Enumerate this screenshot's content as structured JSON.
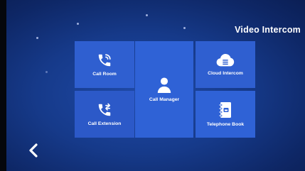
{
  "header": {
    "title": "Video Intercom"
  },
  "tiles": [
    {
      "label": "Call Room",
      "icon": "phone-ring-icon"
    },
    {
      "label": "Call Extension",
      "icon": "phone-transfer-icon"
    },
    {
      "label": "Call Manager",
      "icon": "person-icon"
    },
    {
      "label": "Cloud Intercom",
      "icon": "cloud-icon"
    },
    {
      "label": "Telephone Book",
      "icon": "address-book-icon"
    }
  ],
  "nav": {
    "back_icon": "chevron-left-icon"
  },
  "colors": {
    "background": "#163a8a",
    "tile": "#2f5fd0",
    "text": "#ffffff"
  }
}
